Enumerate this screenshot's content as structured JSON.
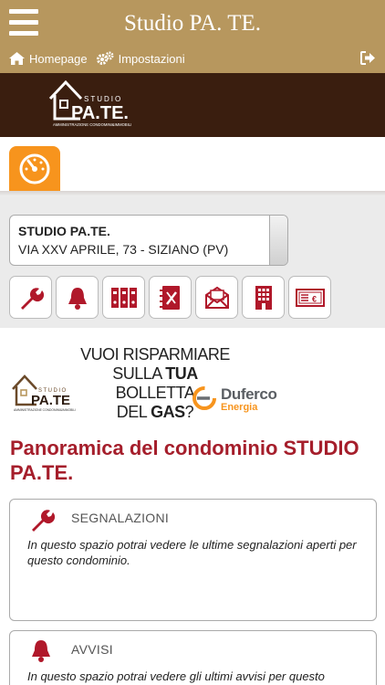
{
  "header": {
    "title": "Studio PA. TE.",
    "nav": [
      {
        "label": "Homepage",
        "icon": "home-icon"
      },
      {
        "label": "Impostazioni",
        "icon": "gears-icon"
      }
    ]
  },
  "brand": {
    "logo_text": "STUDIO PA.TE.",
    "logo_subtitle": "AMMINISTRAZIONE CONDOMINI&IMMOBILI"
  },
  "selector": {
    "name": "STUDIO PA.TE.",
    "address": "VIA XXV APRILE, 73 - SIZIANO (PV)"
  },
  "icon_buttons": [
    {
      "icon": "wrench-icon"
    },
    {
      "icon": "bell-icon"
    },
    {
      "icon": "binders-icon"
    },
    {
      "icon": "notebook-tools-icon"
    },
    {
      "icon": "envelope-document-icon"
    },
    {
      "icon": "building-icon"
    },
    {
      "icon": "euro-banknote-icon"
    }
  ],
  "promo": {
    "line1": "VUOI RISPARMIARE",
    "line2_pre": "SULLA ",
    "line2_bold": "TUA",
    "line2_post": " BOLLETTA",
    "line3_pre": "DEL ",
    "line3_bold": "GAS",
    "line3_post": "?",
    "brand1": "Duferco",
    "brand2": "Energia"
  },
  "main": {
    "heading": "Panoramica del condominio STUDIO PA.TE.",
    "cards": [
      {
        "title": "SEGNALAZIONI",
        "body": "In questo spazio potrai vedere le ultime segnalazioni aperti per questo condominio."
      },
      {
        "title": "AVVISI",
        "body": "In questo spazio potrai vedere gli ultimi avvisi per questo"
      }
    ]
  },
  "colors": {
    "header": "#b7975e",
    "brand_band": "#3a1e0f",
    "accent_orange": "#f7941d",
    "icon_red": "#b0182a",
    "heading_red": "#a51e2b"
  }
}
